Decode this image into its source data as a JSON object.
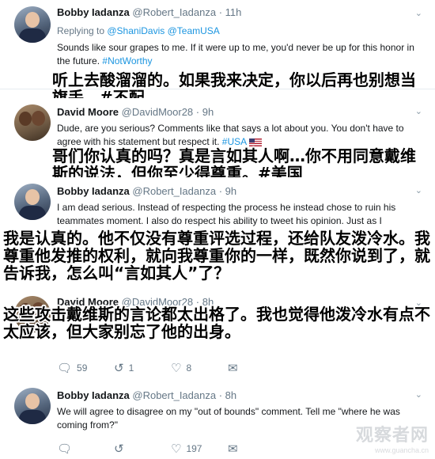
{
  "tweets": [
    {
      "name": "Bobby Iadanza",
      "handle": "@Robert_Iadanza",
      "time": "· 11h",
      "reply_prefix": "Replying to ",
      "reply_to_1": "@ShaniDavis",
      "reply_to_2": "@TeamUSA",
      "text": "Sounds like sour grapes to me.  If it were up to me, you'd never be up for this honor in the future.",
      "hashtag": "#NotWorthy",
      "overlay": "听上去酸溜溜的。如果我来决定，你以后再也别想当旗手。#不配"
    },
    {
      "name": "David Moore",
      "handle": "@DavidMoor28",
      "time": "· 9h",
      "text": "Dude, are you serious?  Comments like that says a lot about you.  You don't have to agree with his statement but respect it.",
      "hashtag": "#USA",
      "overlay": "哥们你认真的吗？真是言如其人啊…你不用同意戴维斯的说法，但你至少得尊重。#美国"
    },
    {
      "name": "Bobby Iadanza",
      "handle": "@Robert_Iadanza",
      "time": "· 9h",
      "text": "I am dead serious. Instead of respecting the process he instead chose to ruin his teammates moment. I also do respect his ability to tweet his opinion. Just as I",
      "overlay": "我是认真的。他不仅没有尊重评选过程，还给队友泼冷水。我尊重他发推的权利，就向我尊重你的一样，既然你说到了，就告诉我，怎么叫“言如其人”了？"
    },
    {
      "name": "David Moore",
      "handle": "@DavidMoor28",
      "time": "· 8h",
      "overlay": "这些攻击戴维斯的言论都太出格了。我也觉得他泼冷水有点不太应该，但大家别忘了他的出身。",
      "replies": "59",
      "retweets": "1",
      "likes": "8"
    },
    {
      "name": "Bobby Iadanza",
      "handle": "@Robert_Iadanza",
      "time": "· 8h",
      "text": "We will agree to disagree on my \"out of bounds\" comment.  Tell me \"where he was coming from?\"",
      "replies": "",
      "retweets": "",
      "likes": "197"
    }
  ],
  "icons": {
    "reply": "reply-icon",
    "retweet": "retweet-icon",
    "like": "heart-icon",
    "mail": "mail-icon",
    "more": "chevron-down-icon"
  },
  "watermark": {
    "brand": "观察者网",
    "url": "www.guancha.cn"
  },
  "colors": {
    "link": "#1b95e0",
    "meta": "#657786"
  }
}
